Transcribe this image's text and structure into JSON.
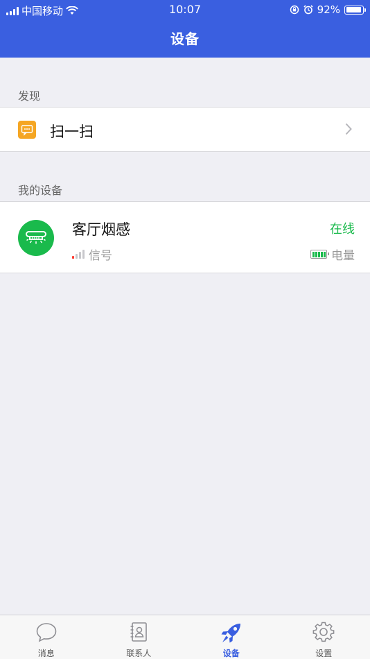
{
  "status_bar": {
    "carrier": "中国移动",
    "time": "10:07",
    "battery_percent": "92%",
    "battery_level": 0.92,
    "icons": [
      "signal-icon",
      "wifi-icon",
      "rotation-lock-icon",
      "alarm-icon",
      "battery-icon"
    ]
  },
  "nav": {
    "title": "设备"
  },
  "discover": {
    "section_label": "发现",
    "scan_label": "扫一扫",
    "icon": "message-icon"
  },
  "my_devices": {
    "section_label": "我的设备",
    "devices": [
      {
        "name": "客厅烟感",
        "status": "在线",
        "signal_label": "信号",
        "power_label": "电量",
        "signal_level": 0.25,
        "battery_level": 1.0
      }
    ]
  },
  "tabbar": {
    "tabs": [
      {
        "label": "消息",
        "icon": "chat-bubble-icon"
      },
      {
        "label": "联系人",
        "icon": "contacts-icon"
      },
      {
        "label": "设备",
        "icon": "rocket-icon",
        "active": true
      },
      {
        "label": "设置",
        "icon": "gear-icon"
      }
    ]
  },
  "colors": {
    "header": "#3a5fe0",
    "online_green": "#1aba4c",
    "scan_orange": "#f5a623",
    "background": "#efeff4",
    "tab_active": "#3a5fe0"
  }
}
